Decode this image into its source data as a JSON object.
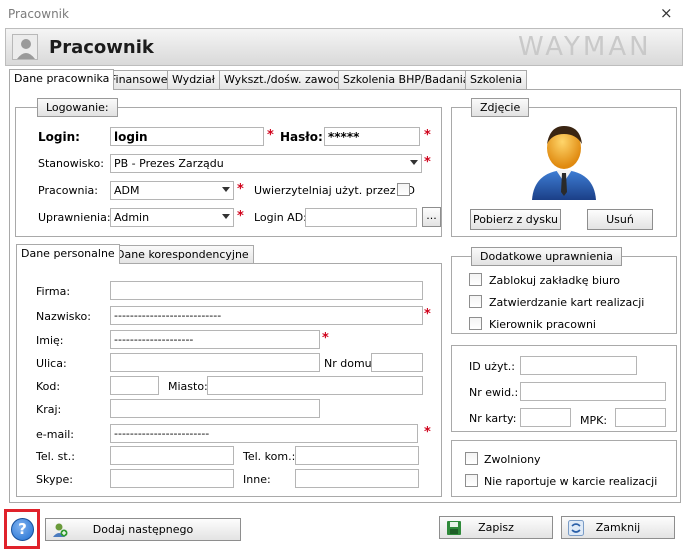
{
  "window": {
    "title": "Pracownik",
    "close": "×"
  },
  "header": {
    "title": "Pracownik",
    "logo": "WAYMAN"
  },
  "tabs": [
    {
      "label": "Dane pracownika"
    },
    {
      "label": "Finansowe"
    },
    {
      "label": "Wydział"
    },
    {
      "label": "Wykszt./dośw. zawod."
    },
    {
      "label": "Szkolenia BHP/Badania"
    },
    {
      "label": "Szkolenia"
    }
  ],
  "login_group": {
    "title": "Logowanie:",
    "login_label": "Login:",
    "login_value": "login",
    "password_label": "Hasło:",
    "password_value": "*****",
    "position_label": "Stanowisko:",
    "position_value": "PB - Prezes Zarządu",
    "workshop_label": "Pracownia:",
    "workshop_value": "ADM",
    "ad_auth_label": "Uwierzytelniaj użyt. przez AD",
    "permissions_label": "Uprawnienia:",
    "permissions_value": "Admin",
    "login_ad_label": "Login AD:",
    "login_ad_value": "",
    "browse_label": "..."
  },
  "required_mark": "*",
  "photo_group": {
    "title": "Zdjęcie",
    "upload_label": "Pobierz z dysku",
    "remove_label": "Usuń"
  },
  "personal_tabs": [
    {
      "label": "Dane personalne"
    },
    {
      "label": "Dane korespondencyjne"
    }
  ],
  "personal": {
    "firma_label": "Firma:",
    "firma_value": "",
    "nazwisko_label": "Nazwisko:",
    "nazwisko_value": "---------------------------",
    "imie_label": "Imię:",
    "imie_value": "--------------------",
    "ulica_label": "Ulica:",
    "ulica_value": "",
    "nr_domu_label": "Nr domu:",
    "nr_domu_value": "",
    "kod_label": "Kod:",
    "kod_value": "",
    "miasto_label": "Miasto:",
    "miasto_value": "",
    "kraj_label": "Kraj:",
    "kraj_value": "",
    "email_label": "e-mail:",
    "email_value": "------------------------",
    "tel_st_label": "Tel. st.:",
    "tel_st_value": "",
    "tel_kom_label": "Tel. kom.:",
    "tel_kom_value": "",
    "skype_label": "Skype:",
    "skype_value": "",
    "inne_label": "Inne:",
    "inne_value": ""
  },
  "extra_permissions": {
    "title": "Dodatkowe uprawnienia",
    "items": [
      {
        "label": "Zablokuj zakładkę biuro"
      },
      {
        "label": "Zatwierdzanie kart realizacji"
      },
      {
        "label": "Kierownik pracowni"
      }
    ]
  },
  "ids": {
    "id_label": "ID użyt.:",
    "id_value": "",
    "nr_ewid_label": "Nr ewid.:",
    "nr_ewid_value": "",
    "nr_karty_label": "Nr karty:",
    "nr_karty_value": "",
    "mpk_label": "MPK:",
    "mpk_value": ""
  },
  "status": {
    "items": [
      {
        "label": "Zwolniony"
      },
      {
        "label": "Nie raportuje w karcie realizacji"
      }
    ]
  },
  "footer": {
    "help": "?",
    "add_next": "Dodaj następnego",
    "save": "Zapisz",
    "close": "Zamknij"
  },
  "colors": {
    "required": "#d0021b",
    "highlight": "#e0222b",
    "help_blue": "#1f6fd1"
  }
}
